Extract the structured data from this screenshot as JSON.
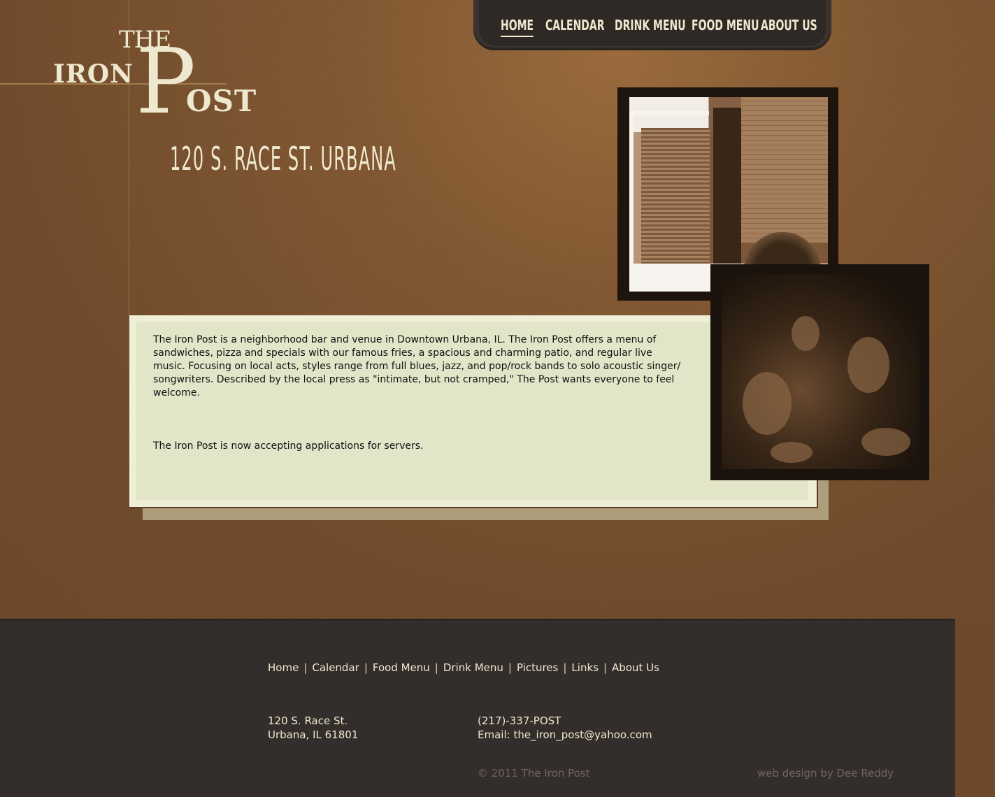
{
  "logo": {
    "the": "THE",
    "iron": "IRON",
    "p": "P",
    "ost": "OST"
  },
  "address_heading": "120 S. RACE ST. URBANA",
  "nav": {
    "items": [
      {
        "label": "HOME",
        "active": true
      },
      {
        "label": "CALENDAR",
        "active": false
      },
      {
        "label": "DRINK MENU",
        "active": false
      },
      {
        "label": "FOOD MENU",
        "active": false
      },
      {
        "label": "ABOUT US",
        "active": false
      }
    ]
  },
  "content": {
    "paragraph1": "The Iron Post is a neighborhood bar and venue in Downtown Urbana, IL. The Iron Post offers a menu of sandwiches, pizza and specials with our famous fries, a spacious and charming patio, and regular live music. Focusing on local acts, styles range from full blues, jazz, and pop/rock bands to solo acoustic singer/ songwriters. Described by the local press as \"intimate, but not cramped,\" The Post wants everyone to feel welcome.",
    "paragraph2": "The Iron Post is now accepting applications for servers."
  },
  "footer": {
    "links": [
      "Home",
      "Calendar",
      "Food Menu",
      "Drink Menu",
      "Pictures",
      "Links",
      "About Us"
    ],
    "separator": "|",
    "address_line1": "120 S. Race St.",
    "address_line2": "Urbana, IL 61801",
    "phone": "(217)-337-POST",
    "email_line": "Email: the_iron_post@yahoo.com",
    "copyright": "© 2011 The Iron Post",
    "credit": "web design by Dee Reddy"
  },
  "colors": {
    "background": "#6f4a2a",
    "cream": "#eee8cf",
    "nav_bg": "#2f2926",
    "footer_bg": "#332e2b",
    "panel_bg": "#e3e5c9"
  }
}
